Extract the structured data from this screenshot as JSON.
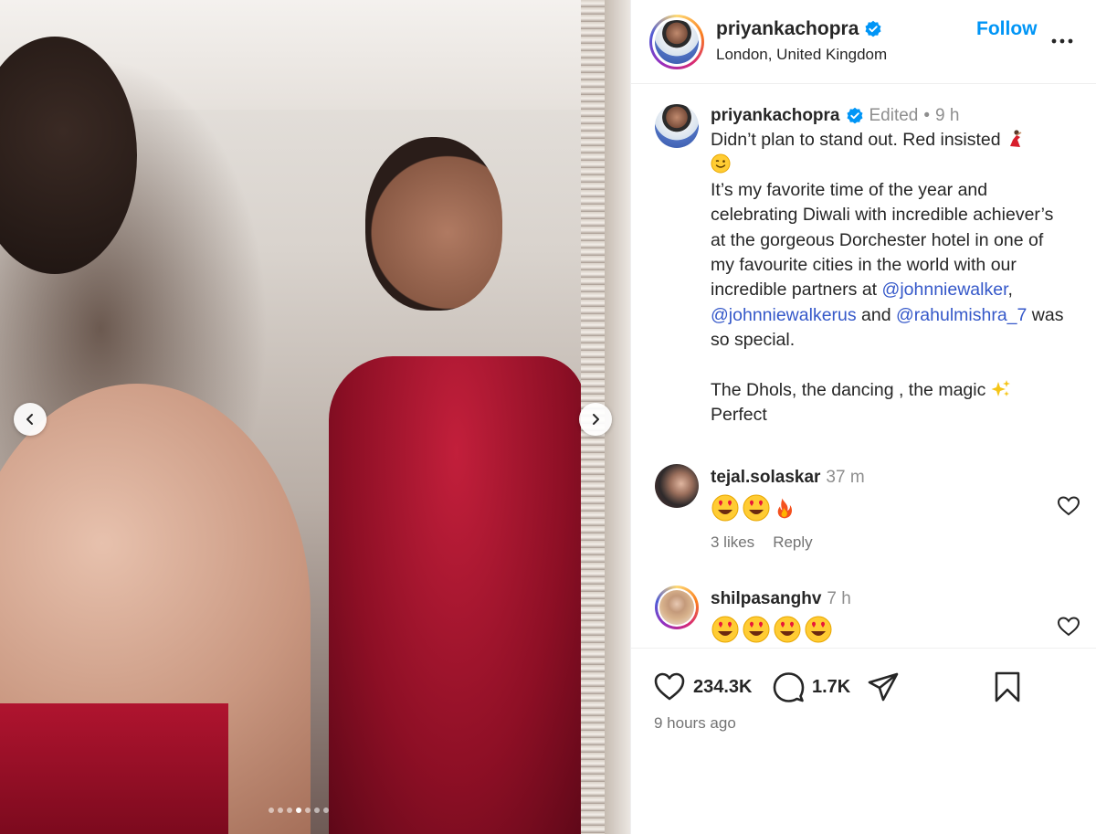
{
  "post": {
    "carousel": {
      "total_slides": 7,
      "active_index": 3
    }
  },
  "header": {
    "username": "priyankachopra",
    "location": "London, United Kingdom",
    "follow_label": "Follow",
    "more_icon": "more-horizontal-icon"
  },
  "caption": {
    "username": "priyankachopra",
    "edited_label": "Edited",
    "separator": "•",
    "time": "9 h",
    "line1": "Didn’t plan to stand out. Red insisted ",
    "line2_a": "It’s my favorite time of the year and celebrating Diwali with incredible achiever’s at the gorgeous Dorchester hotel in one of my favourite cities in the world with our incredible partners at ",
    "mention1": "@johnniewalker",
    "comma": ", ",
    "mention2": "@johnniewalkerus",
    "and_text": " and ",
    "mention3": "@rahulmishra_7",
    "line2_end": " was so special.",
    "line3": "The Dhols, the dancing , the magic ",
    "line4": "Perfect"
  },
  "comments": [
    {
      "username": "tejal.solaskar",
      "time": "37 m",
      "likes_label": "3 likes",
      "reply_label": "Reply"
    },
    {
      "username": "shilpasanghv",
      "time": "7 h"
    }
  ],
  "actions": {
    "like_count": "234.3K",
    "comment_count": "1.7K",
    "time_ago": "9 hours ago"
  },
  "colors": {
    "follow": "#0095f6",
    "verified": "#0095f6",
    "mention": "#3558c9",
    "dress_red": "#9a0f2a"
  }
}
